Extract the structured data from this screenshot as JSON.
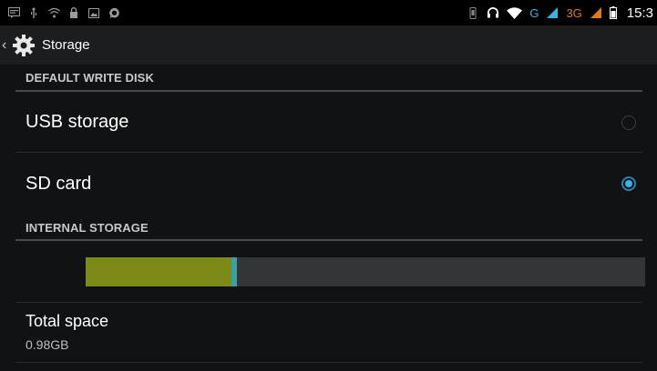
{
  "status_bar": {
    "left_icons": [
      "message-icon",
      "usb-icon",
      "wifi-notification-icon",
      "lock-icon",
      "image-icon",
      "whatsapp-icon"
    ],
    "right_icons": [
      "vibrate-icon",
      "headset-icon",
      "wifi-icon",
      "signal-icon",
      "signal-icon-2",
      "battery-icon"
    ],
    "network_g": "G",
    "network_3g": "3G",
    "clock": "15:3"
  },
  "action_bar": {
    "title": "Storage"
  },
  "default_write_disk": {
    "header": "DEFAULT WRITE DISK",
    "options": [
      {
        "label": "USB storage",
        "selected": false
      },
      {
        "label": "SD card",
        "selected": true
      }
    ]
  },
  "internal_storage": {
    "header": "INTERNAL STORAGE",
    "usage": {
      "apps_fraction": 0.26,
      "other_fraction": 0.01,
      "apps_color": "#7e8a17",
      "other_color": "#3aa0a6",
      "free_color": "#343537"
    },
    "total_space_label": "Total space",
    "total_space_value": "0.98GB"
  },
  "colors": {
    "accent": "#33b5e5",
    "background": "#111214",
    "status_bar": "#000000"
  }
}
